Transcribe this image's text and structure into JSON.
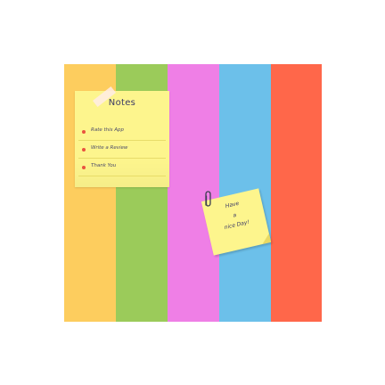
{
  "colors": {
    "stripe_yellow": "#fdcd5e",
    "stripe_green": "#9bcb5a",
    "stripe_pink": "#ef7fe6",
    "stripe_blue": "#6cc0ea",
    "stripe_red": "#ff674a",
    "note_yellow": "#fdf58d",
    "bullet_red": "#e9533f",
    "ink": "#3b3a66"
  },
  "main_note": {
    "title": "Notes",
    "items": [
      {
        "label": "Rate this App"
      },
      {
        "label": "Write a Review"
      },
      {
        "label": "Thank You"
      }
    ]
  },
  "small_note": {
    "lines": [
      "Have",
      "a",
      "nice Day!"
    ]
  },
  "icons": {
    "clip": "paperclip-icon",
    "tape": "tape-strip"
  }
}
